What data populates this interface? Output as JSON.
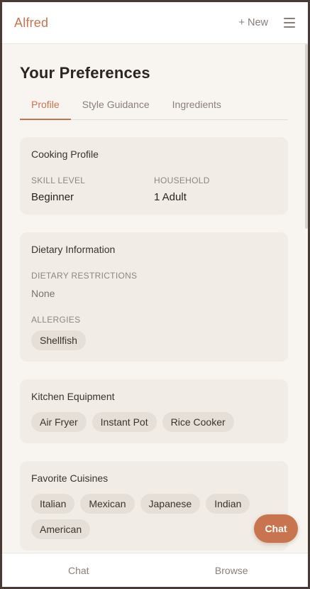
{
  "header": {
    "brand": "Alfred",
    "new_label": "+ New"
  },
  "page_title": "Your Preferences",
  "tabs": [
    {
      "label": "Profile",
      "active": true
    },
    {
      "label": "Style Guidance",
      "active": false
    },
    {
      "label": "Ingredients",
      "active": false
    }
  ],
  "cooking_profile": {
    "title": "Cooking Profile",
    "skill_label": "SKILL LEVEL",
    "skill_value": "Beginner",
    "household_label": "HOUSEHOLD",
    "household_value": "1 Adult"
  },
  "dietary": {
    "title": "Dietary Information",
    "restrictions_label": "DIETARY RESTRICTIONS",
    "restrictions_value": "None",
    "allergies_label": "ALLERGIES",
    "allergies": [
      "Shellfish"
    ]
  },
  "equipment": {
    "title": "Kitchen Equipment",
    "items": [
      "Air Fryer",
      "Instant Pot",
      "Rice Cooker"
    ]
  },
  "cuisines": {
    "title": "Favorite Cuisines",
    "items": [
      "Italian",
      "Mexican",
      "Japanese",
      "Indian",
      "American"
    ]
  },
  "fab_label": "Chat",
  "bottom_nav": [
    {
      "label": "Chat"
    },
    {
      "label": "Browse"
    }
  ],
  "colors": {
    "accent": "#c8744f",
    "background": "#f8f5f1",
    "card": "#f1ece6",
    "chip": "#e6dfd8"
  }
}
